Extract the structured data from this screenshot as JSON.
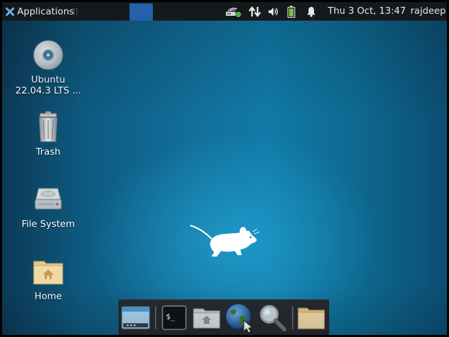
{
  "panel": {
    "app_menu_label": "Applications",
    "clock": "Thu  3 Oct, 13:47",
    "user": "rajdeep",
    "tray_icons": [
      "network-icon",
      "transfer-arrows-icon",
      "volume-icon",
      "battery-icon",
      "notification-bell-icon"
    ]
  },
  "desktop": {
    "icons": [
      {
        "label_line1": "Ubuntu",
        "label_line2": "22.04.3 LTS ...",
        "icon": "optical-disc-icon"
      },
      {
        "label": "Trash",
        "icon": "trash-icon"
      },
      {
        "label": "File System",
        "icon": "hard-drive-icon"
      },
      {
        "label": "Home",
        "icon": "home-folder-icon"
      }
    ]
  },
  "dock": {
    "items": [
      "show-desktop-icon",
      "terminal-icon",
      "home-folder-icon",
      "web-browser-icon",
      "search-icon",
      "file-manager-icon"
    ],
    "terminal_prompt": "$_"
  },
  "colors": {
    "panel_bg": "#15191c",
    "workspace_active": "#2361a8",
    "desktop_blue": "#117aa8"
  }
}
